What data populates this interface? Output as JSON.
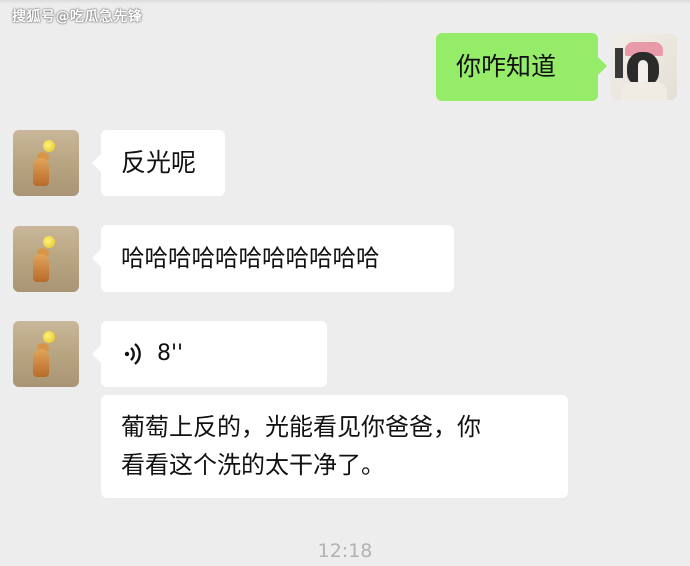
{
  "watermark": "搜狐号@吃瓜急先锋",
  "messages": [
    {
      "side": "right",
      "type": "text",
      "text": "你咋知道",
      "sender": "me"
    },
    {
      "side": "left",
      "type": "text",
      "text": "反光呢"
    },
    {
      "side": "left",
      "type": "text",
      "text": "哈哈哈哈哈哈哈哈哈哈哈"
    },
    {
      "side": "left",
      "type": "voice",
      "duration": "8''",
      "icon": "voice-wave-icon"
    },
    {
      "side": "left",
      "type": "text",
      "line1": "葡萄上反的，光能看见你爸爸，你",
      "line2": "看看这个洗的太干净了。"
    }
  ],
  "timestamp": "12:18",
  "colors": {
    "background": "#ededed",
    "bubble_self": "#95ec69",
    "bubble_other": "#ffffff",
    "timestamp": "#b2b2b2"
  }
}
